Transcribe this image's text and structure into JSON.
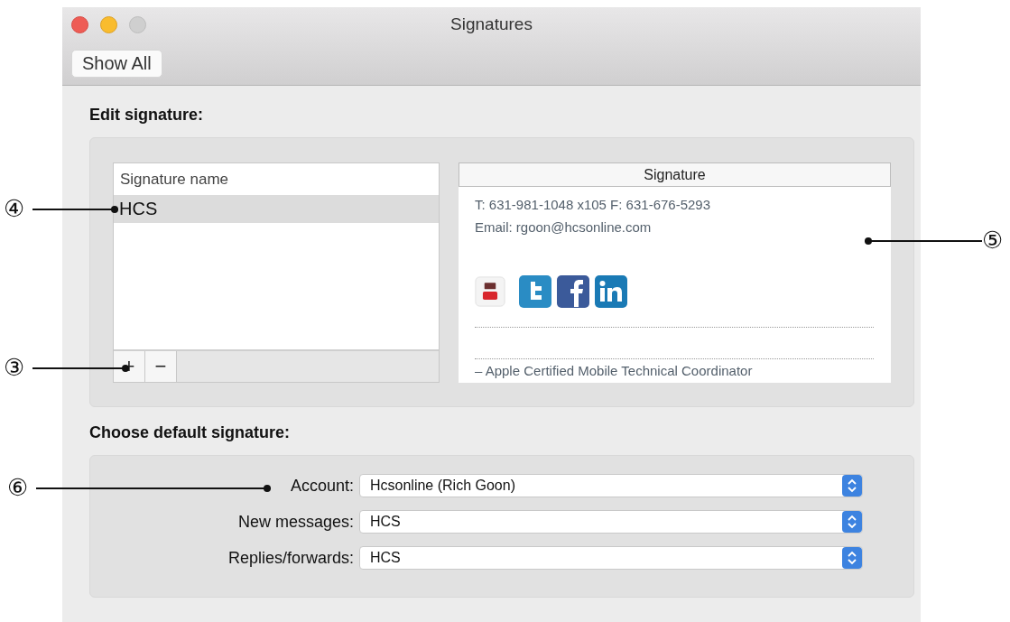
{
  "window": {
    "title": "Signatures"
  },
  "toolbar": {
    "buttons": [
      "Show All"
    ]
  },
  "edit_signature": {
    "heading": "Edit signature:",
    "list": {
      "column": "Signature name",
      "rows": [
        {
          "name": "HCS",
          "selected": true
        }
      ],
      "buttons": [
        "+",
        "−"
      ]
    },
    "preview": {
      "heading": "Signature",
      "lines": [
        "T: 631-981-1048 x105 F: 631-676-5293",
        "Email: rgoon@hcsonline.com"
      ],
      "footer_line": "– Apple Certified Mobile Technical Coordinator"
    }
  },
  "default_signature": {
    "heading": "Choose default signature:",
    "fields": [
      {
        "label": "Account:",
        "value": "Hcsonline (Rich Goon)"
      },
      {
        "label": "New messages:",
        "value": "HCS"
      },
      {
        "label": "Replies/forwards:",
        "value": "HCS"
      }
    ]
  },
  "callouts": [
    {
      "label": "④"
    },
    {
      "label": "③"
    },
    {
      "label": "⑤"
    },
    {
      "label": "⑥"
    }
  ]
}
